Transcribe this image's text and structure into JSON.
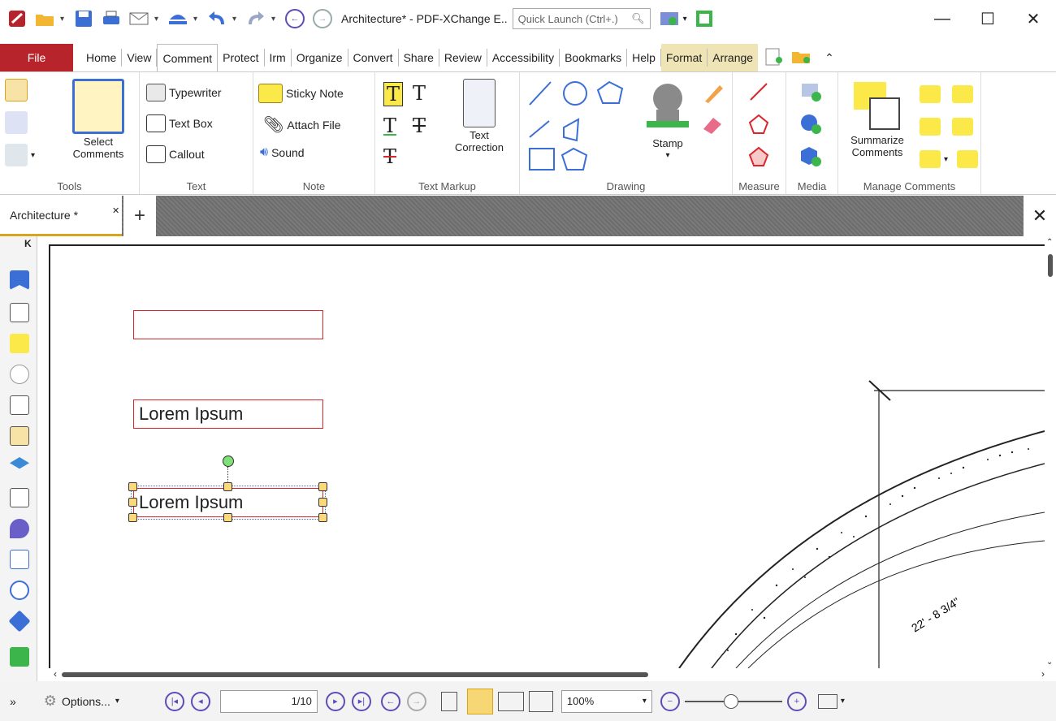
{
  "window": {
    "title": "Architecture* - PDF-XChange E..",
    "quick_launch_placeholder": "Quick Launch (Ctrl+.)",
    "minimize": "—",
    "maximize": "☐",
    "close": "✕"
  },
  "menu": {
    "file": "File",
    "items": [
      "Home",
      "View",
      "Comment",
      "Protect",
      "Irm",
      "Organize",
      "Convert",
      "Share",
      "Review",
      "Accessibility",
      "Bookmarks",
      "Help"
    ],
    "active": "Comment",
    "context_items": [
      "Format",
      "Arrange"
    ]
  },
  "ribbon": {
    "tools": {
      "label": "Tools",
      "select_comments": "Select Comments"
    },
    "text": {
      "label": "Text",
      "typewriter": "Typewriter",
      "text_box": "Text Box",
      "callout": "Callout"
    },
    "note": {
      "label": "Note",
      "sticky_note": "Sticky Note",
      "attach_file": "Attach File",
      "sound": "Sound"
    },
    "text_markup": {
      "label": "Text Markup",
      "text_correction": "Text Correction"
    },
    "drawing": {
      "label": "Drawing",
      "stamp": "Stamp"
    },
    "measure": {
      "label": "Measure"
    },
    "media": {
      "label": "Media"
    },
    "manage_comments": {
      "label": "Manage Comments",
      "summarize": "Summarize Comments"
    }
  },
  "tabs": {
    "document": "Architecture *",
    "new_tab": "+",
    "close_all": "✕"
  },
  "page": {
    "annotation2_text": "Lorem Ipsum",
    "annotation3_text": "Lorem Ipsum",
    "dimension_text": "22' - 8 3/4\""
  },
  "status": {
    "options": "Options...",
    "page_display": "1/10",
    "zoom": "100%"
  },
  "colors": {
    "file_menu": "#b8242b",
    "annotation_border": "#d9262b",
    "context_tab": "#efe4b5",
    "nav_button": "#5c4db8"
  }
}
